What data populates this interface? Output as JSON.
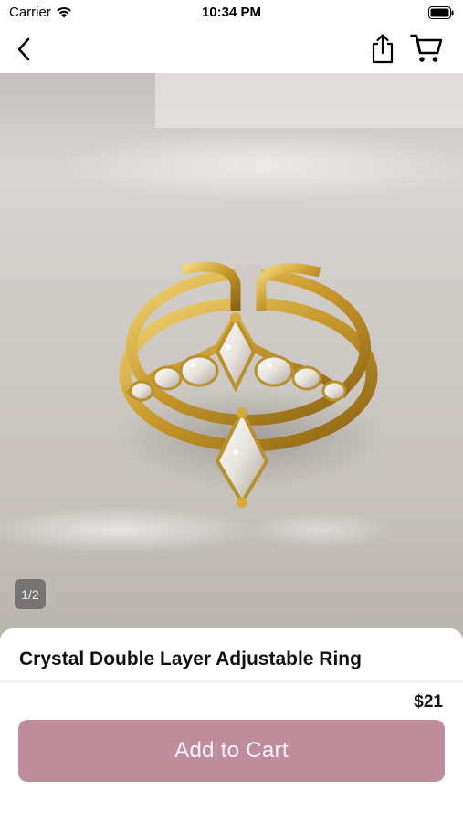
{
  "status_bar": {
    "carrier": "Carrier",
    "time": "10:34 PM"
  },
  "nav": {
    "back_icon": "chevron-left-icon",
    "share_icon": "share-icon",
    "cart_icon": "shopping-cart-icon"
  },
  "product": {
    "image_description_icon": "ring-photo",
    "image_indicator": "1/2",
    "title": "Crystal Double Layer Adjustable Ring",
    "price": "$21"
  },
  "actions": {
    "add_to_cart_label": "Add to Cart"
  },
  "colors": {
    "accent": "#bf8c9c",
    "button_text": "#fbf6f8"
  }
}
